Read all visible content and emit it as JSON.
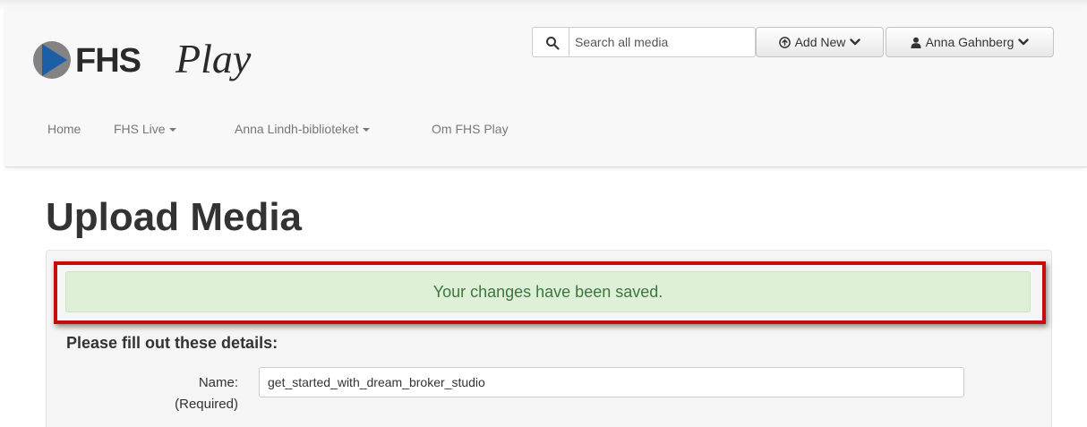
{
  "app": {
    "logo_text": "FHS",
    "logo_script": "Play"
  },
  "search": {
    "placeholder": "Search all media",
    "value": ""
  },
  "toolbar": {
    "add_new_label": "Add New",
    "user_label": "Anna Gahnberg"
  },
  "nav": {
    "items": [
      {
        "label": "Home",
        "dropdown": false
      },
      {
        "label": "FHS Live",
        "dropdown": true
      },
      {
        "label": "Anna Lindh-biblioteket",
        "dropdown": true
      },
      {
        "label": "Om FHS Play",
        "dropdown": false
      }
    ]
  },
  "page": {
    "title": "Upload Media"
  },
  "alert": {
    "message": "Your changes have been saved.",
    "type": "success"
  },
  "form": {
    "heading": "Please fill out these details:",
    "name_label": "Name:",
    "name_required": "(Required)",
    "name_value": "get_started_with_dream_broker_studio"
  },
  "colors": {
    "logo_accent": "#1d5fa6",
    "highlight_frame": "#c40d0d",
    "alert_bg": "#dff0d8",
    "alert_text": "#3c763d"
  },
  "icons": {
    "search": "search-icon",
    "add": "plus-circle-icon",
    "user": "user-icon",
    "chevron": "chevron-down-icon"
  }
}
